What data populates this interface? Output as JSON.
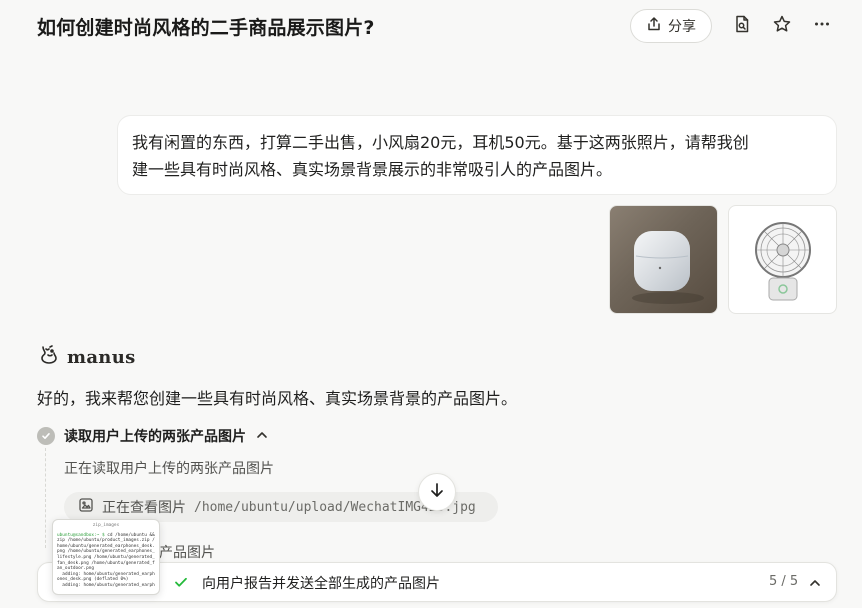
{
  "header": {
    "title": "如何创建时尚风格的二手商品展示图片?",
    "share_label": "分享"
  },
  "user_message": {
    "line1": "我有闲置的东西，打算二手出售，小风扇20元，耳机50元。基于这两张照片，请帮我创",
    "line2": "建一些具有时尚风格、真实场景背景展示的非常吸引人的产品图片。"
  },
  "assistant": {
    "name": "manus",
    "reply": "好的，我来帮您创建一些具有时尚风格、真实场景背景的产品图片。",
    "step": {
      "title": "读取用户上传的两张产品图片",
      "description": "正在读取用户上传的两张产品图片",
      "tool_action": "正在查看图片",
      "tool_path": "/home/ubuntu/upload/WechatIMG423.jpg",
      "partial_text": "张产品图片"
    }
  },
  "task_bar": {
    "label": "向用户报告并发送全部生成的产品图片",
    "progress": "5 / 5"
  },
  "terminal_preview": {
    "title": "zip_images",
    "prompt": "ubuntu@sandbox:~ $",
    "command": " cd /home/ubuntu && zip /home/ubuntu/product_images.zip /home/ubuntu/generated_earphones_desk.png /home/ubuntu/generated_earphones_lifestyle.png /home/ubuntu/generated_fan_desk.png /home/ubuntu/generated_fan_outdoor.png",
    "output1": "  adding: home/ubuntu/generated_earphones_desk.png (deflated 0%)",
    "output2": "  adding: home/ubuntu/generated_earph"
  },
  "colors": {
    "background": "#f8f8f7",
    "bubble": "#ffffff",
    "check_green": "#25ba3b",
    "muted": "#bdbdb8"
  }
}
